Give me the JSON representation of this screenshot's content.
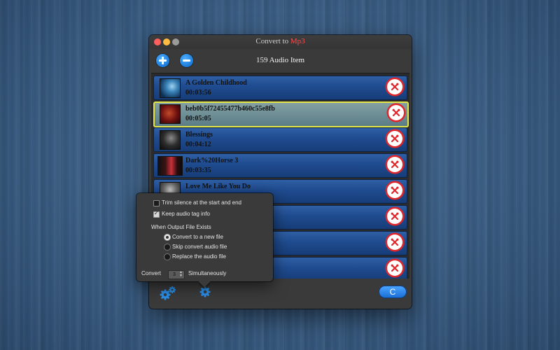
{
  "window": {
    "title_prefix": "Convert to ",
    "title_accent": "Mp3",
    "item_count": "159 Audio Item",
    "accent_color": "#ff4d4d"
  },
  "toolbar": {
    "add_icon": "plus-icon",
    "remove_icon": "minus-icon"
  },
  "items": [
    {
      "name": "A Golden Childhood",
      "duration": "00:03:56",
      "selected": false
    },
    {
      "name": "beb0b5f72455477b460c55e8fb",
      "duration": "00:05:05",
      "selected": true
    },
    {
      "name": "Blessings",
      "duration": "00:04:12",
      "selected": false
    },
    {
      "name": "Dark%20Horse 3",
      "duration": "00:03:35",
      "selected": false
    },
    {
      "name": "Love Me Like You Do",
      "duration": "",
      "selected": false
    },
    {
      "name": "",
      "duration": "",
      "selected": false
    },
    {
      "name": "",
      "duration": "",
      "selected": false
    },
    {
      "name": "",
      "duration": "",
      "selected": false
    }
  ],
  "settings": {
    "trim_silence": {
      "label": "Trim silence at the start and end",
      "checked": false
    },
    "keep_tags": {
      "label": "Keep audio tag info",
      "checked": true
    },
    "output_exists_heading": "When Output File Exists",
    "options": [
      {
        "label": "Convert to a new file",
        "selected": true
      },
      {
        "label": "Skip convert audio file",
        "selected": false
      },
      {
        "label": "Replace the audio file",
        "selected": false
      }
    ],
    "convert_label": "Convert",
    "simultaneous_value": "3",
    "simultaneous_label": "Simultaneously"
  },
  "bottom": {
    "refresh_label": "C"
  }
}
